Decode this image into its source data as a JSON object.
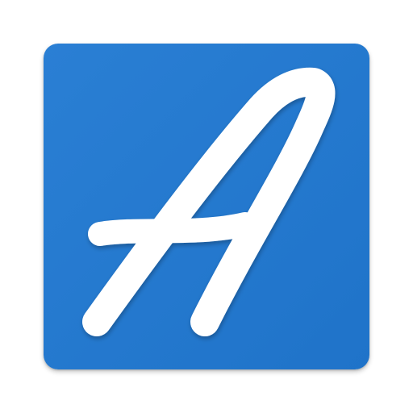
{
  "app_icon": {
    "glyph_icon": "script-letter-a-icon",
    "colors": {
      "background": "#1f73c9",
      "background_light": "#2a7fd4",
      "glyph": "#ffffff",
      "page": "#ffffff"
    }
  }
}
